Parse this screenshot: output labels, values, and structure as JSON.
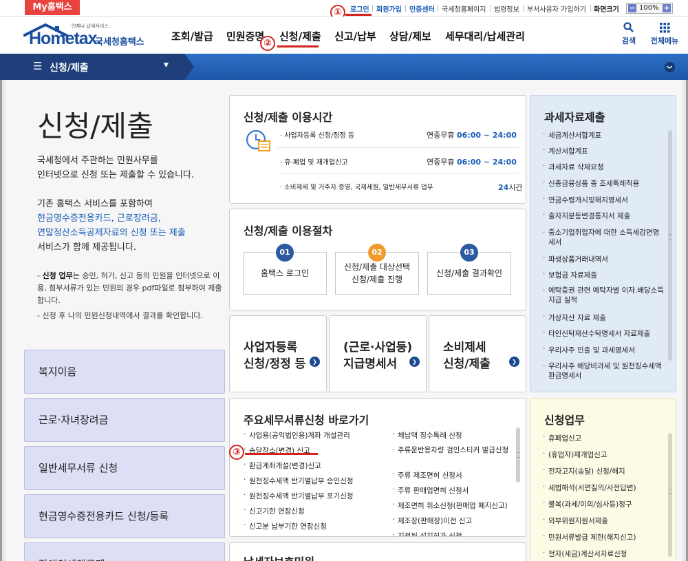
{
  "utilbar": {
    "my_hometax": "My홈택스",
    "login": "로그인",
    "signup": "회원가입",
    "cert": "인증센터",
    "nts_home": "국세청홈페이지",
    "law": "법령정보",
    "dept_user": "부서사용자 가입하기",
    "screen_size": "화면크기",
    "zoom_minus": "−",
    "zoom_value": "100%",
    "zoom_plus": "+"
  },
  "annotations": {
    "n1": "①",
    "n2": "②",
    "n3": "③"
  },
  "logo": {
    "tagline": "언제나 납세서비스",
    "home": "Hometax.",
    "nts": "국세청홈택스"
  },
  "gnb": {
    "items": [
      "조회/발급",
      "민원증명",
      "신청/제출",
      "신고/납부",
      "상담/제보",
      "세무대리/납세관리"
    ],
    "search": "검색",
    "all_menu": "전체메뉴"
  },
  "bluebar": {
    "menu_icon": "☰",
    "title": "신청/제출",
    "dropdown": "▼",
    "right_icon": "❯"
  },
  "left": {
    "title": "신청/제출",
    "intro1": "국세청에서 주관하는 민원사무를",
    "intro2": "인터넷으로 신청 또는 제출할 수 있습니다.",
    "intro3": "기존 홈택스 서비스를 포함하여",
    "intro4": "현금영수증전용카드, 근로장려금,",
    "intro5": "연말정산소득공제자료의 신청 또는 제출",
    "intro6": "서비스가 함께 제공됩니다.",
    "note1_bold": "신청 업무",
    "note1": "는 승인, 허가, 신고 등의 민원을 인터넷으로 이용, 첨부서류가 있는 민원의 경우 pdf파일로 첨부하여 제출합니다.",
    "note2": "신청 후 나의 민원신청내역에서 결과를 확인합니다.",
    "buttons": [
      "복지이음",
      "근로·자녀장려금",
      "일반세무서류 신청",
      "현금영수증전용카드 신청/등록",
      "장애인세액공제"
    ]
  },
  "hours": {
    "title": "신청/제출 이용시간",
    "rows": [
      {
        "name": "사업자등록 신청/정정 등",
        "label": "연중무휴",
        "time": "06:00 ~ 24:00"
      },
      {
        "name": "휴·폐업 및 재개업신고",
        "label": "연중무휴",
        "time": "06:00 ~ 24:00"
      },
      {
        "name": "소비제세 및 거주자 증명, 국제세원, 일반세무서류 업무",
        "label": "",
        "time": "24",
        "time_unit": "시간"
      }
    ]
  },
  "procedure": {
    "title": "신청/제출 이용절차",
    "steps": [
      {
        "num": "01",
        "l1": "홈택스 로그인",
        "l2": ""
      },
      {
        "num": "02",
        "l1": "신청/제출 대상선택",
        "l2": "신청/제출 진행"
      },
      {
        "num": "03",
        "l1": "신청/제출 결과확인",
        "l2": ""
      }
    ]
  },
  "bigbtns": [
    {
      "l1": "사업자등록",
      "l2": "신청/정정 등"
    },
    {
      "l1": "(근로·사업등)",
      "l2": "지급명세서"
    },
    {
      "l1": "소비제세",
      "l2": "신청/제출"
    }
  ],
  "shortcuts": {
    "title": "주요세무서류신청 바로가기",
    "col1": [
      "사업용(공익법인용)계좌 개설관리",
      "송달장소(변경) 신고",
      "환급계좌개설(변경)신고",
      "원천징수세액 반기별납부 승인신청",
      "원천징수세액 반기별납부 포기신청",
      "신고기한 연장신청",
      "신고분 납부기한 연장신청"
    ],
    "col2": [
      "체납액 징수특례 신청",
      "주류운반용차량 검인스티커 발급신청",
      "주류 제조면허 신청서",
      "주류 판매업면허 신청서",
      "제조면허 취소신청(판매업 폐지신고)",
      "제조장(판매장)이전 신고",
      "지정된 설치허가 신청"
    ]
  },
  "next_section": {
    "title": "납세자보호민원"
  },
  "tax_data": {
    "title": "과세자료제출",
    "items": [
      "세금계산서합계표",
      "계산서합계표",
      "과세자료 삭제요청",
      "신종금융상품 중 조세특례적용",
      "연금수령개시및해지명세서",
      "출자지분등변경통지서 제출",
      "중소기업취업자에 대한 소득세감면명세서",
      "파생상품거래내역서",
      "보험금 자료제출",
      "예탁증권 관련 예탁자별 이자.배당소득 지급 실적",
      "가상자산 자료 제출",
      "타인신탁재산수탁명세서 자료제출",
      "우리사주 인출 및 과세명세서",
      "우리사주 배당비과세 및 원천징수세액환급명세서"
    ]
  },
  "apply_work": {
    "title": "신청업무",
    "items": [
      "휴폐업신고",
      "(휴업자)재개업신고",
      "전자고지(송달) 신청/해지",
      "세법해석(서면질의/사전답변)",
      "불복(과세/이의/심사등)청구",
      "외부위원지원서제출",
      "민원서류발급 제한(해지신고)",
      "전자(세금)계산서자료신청"
    ]
  }
}
